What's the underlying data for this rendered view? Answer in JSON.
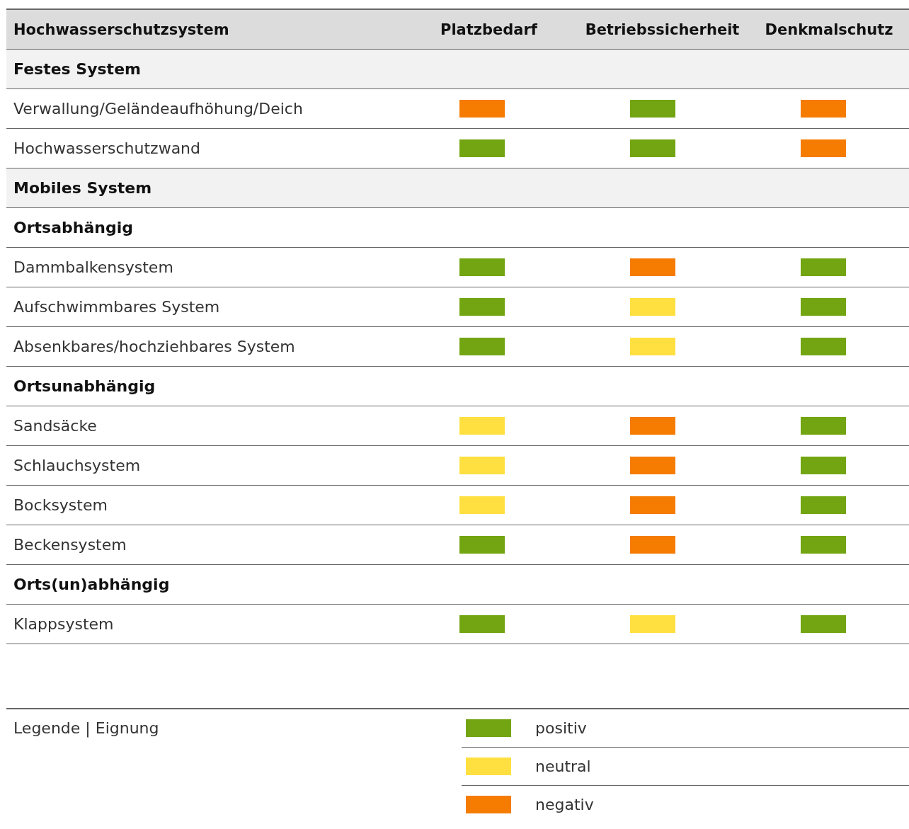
{
  "table": {
    "columns": [
      "Hochwasserschutzsystem",
      "Platzbedarf",
      "Betriebssicherheit",
      "Denkmalschutz"
    ],
    "rows": [
      {
        "kind": "section",
        "label": "Festes System"
      },
      {
        "kind": "item",
        "label": "Verwallung/Geländeaufhöhung/Deich",
        "cells": [
          {
            "color": "#f57c00"
          },
          {
            "color": "#72a511"
          },
          {
            "color": "#f57c00"
          }
        ]
      },
      {
        "kind": "item",
        "label": "Hochwasserschutzwand",
        "cells": [
          {
            "color": "#72a511"
          },
          {
            "color": "#72a511"
          },
          {
            "color": "#f57c00"
          }
        ]
      },
      {
        "kind": "section",
        "label": "Mobiles System"
      },
      {
        "kind": "group",
        "label": "Ortsabhängig"
      },
      {
        "kind": "item",
        "label": "Dammbalkensystem",
        "cells": [
          {
            "color": "#72a511"
          },
          {
            "color": "#f57c00"
          },
          {
            "color": "#72a511"
          }
        ]
      },
      {
        "kind": "item",
        "label": "Aufschwimmbares System",
        "cells": [
          {
            "color": "#72a511"
          },
          {
            "color": "#ffe040"
          },
          {
            "color": "#72a511"
          }
        ]
      },
      {
        "kind": "item",
        "label": "Absenkbares/hochziehbares System",
        "cells": [
          {
            "color": "#72a511"
          },
          {
            "color": "#ffe040"
          },
          {
            "color": "#72a511"
          }
        ]
      },
      {
        "kind": "group",
        "label": "Ortsunabhängig"
      },
      {
        "kind": "item",
        "label": "Sandsäcke",
        "cells": [
          {
            "color": "#ffe040"
          },
          {
            "color": "#f57c00"
          },
          {
            "color": "#72a511"
          }
        ]
      },
      {
        "kind": "item",
        "label": "Schlauchsystem",
        "cells": [
          {
            "color": "#ffe040"
          },
          {
            "color": "#f57c00"
          },
          {
            "color": "#72a511"
          }
        ]
      },
      {
        "kind": "item",
        "label": "Bocksystem",
        "cells": [
          {
            "color": "#ffe040"
          },
          {
            "color": "#f57c00"
          },
          {
            "color": "#72a511"
          }
        ]
      },
      {
        "kind": "item",
        "label": "Beckensystem",
        "cells": [
          {
            "color": "#72a511"
          },
          {
            "color": "#f57c00"
          },
          {
            "color": "#72a511"
          }
        ]
      },
      {
        "kind": "group",
        "label": "Orts(un)abhängig"
      },
      {
        "kind": "item",
        "label": "Klappsystem",
        "cells": [
          {
            "color": "#72a511"
          },
          {
            "color": "#ffe040"
          },
          {
            "color": "#72a511"
          }
        ]
      }
    ]
  },
  "legend": {
    "title": "Legende | Eignung",
    "items": [
      {
        "label": "positiv",
        "color": "#72a511"
      },
      {
        "label": "neutral",
        "color": "#ffe040"
      },
      {
        "label": "negativ",
        "color": "#f57c00"
      }
    ]
  }
}
